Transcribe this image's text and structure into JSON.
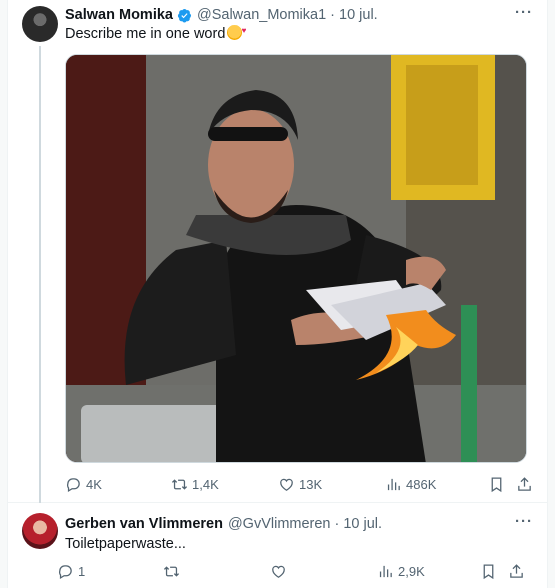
{
  "tweets": [
    {
      "author_name": "Salwan Momika",
      "handle": "@Salwan_Momika1",
      "separator": "·",
      "date": "10 jul.",
      "text": "Describe me in one word",
      "verified": true,
      "actions": {
        "replies": "4K",
        "reposts": "1,4K",
        "likes": "13K",
        "views": "486K"
      }
    },
    {
      "author_name": "Gerben van Vlimmeren",
      "handle": "@GvVlimmeren",
      "separator": "·",
      "date": "10 jul.",
      "text": "Toiletpaperwaste...",
      "verified": false,
      "actions": {
        "replies": "1",
        "reposts": "",
        "likes": "",
        "views": "2,9K"
      }
    }
  ],
  "more_label": "···",
  "colors": {
    "verified": "#1d9bf0",
    "muted": "#536471",
    "text": "#0f1419"
  },
  "icons": [
    "verified-badge-icon",
    "reply-icon",
    "repost-icon",
    "like-icon",
    "views-icon",
    "bookmark-icon",
    "share-icon",
    "more-icon"
  ]
}
